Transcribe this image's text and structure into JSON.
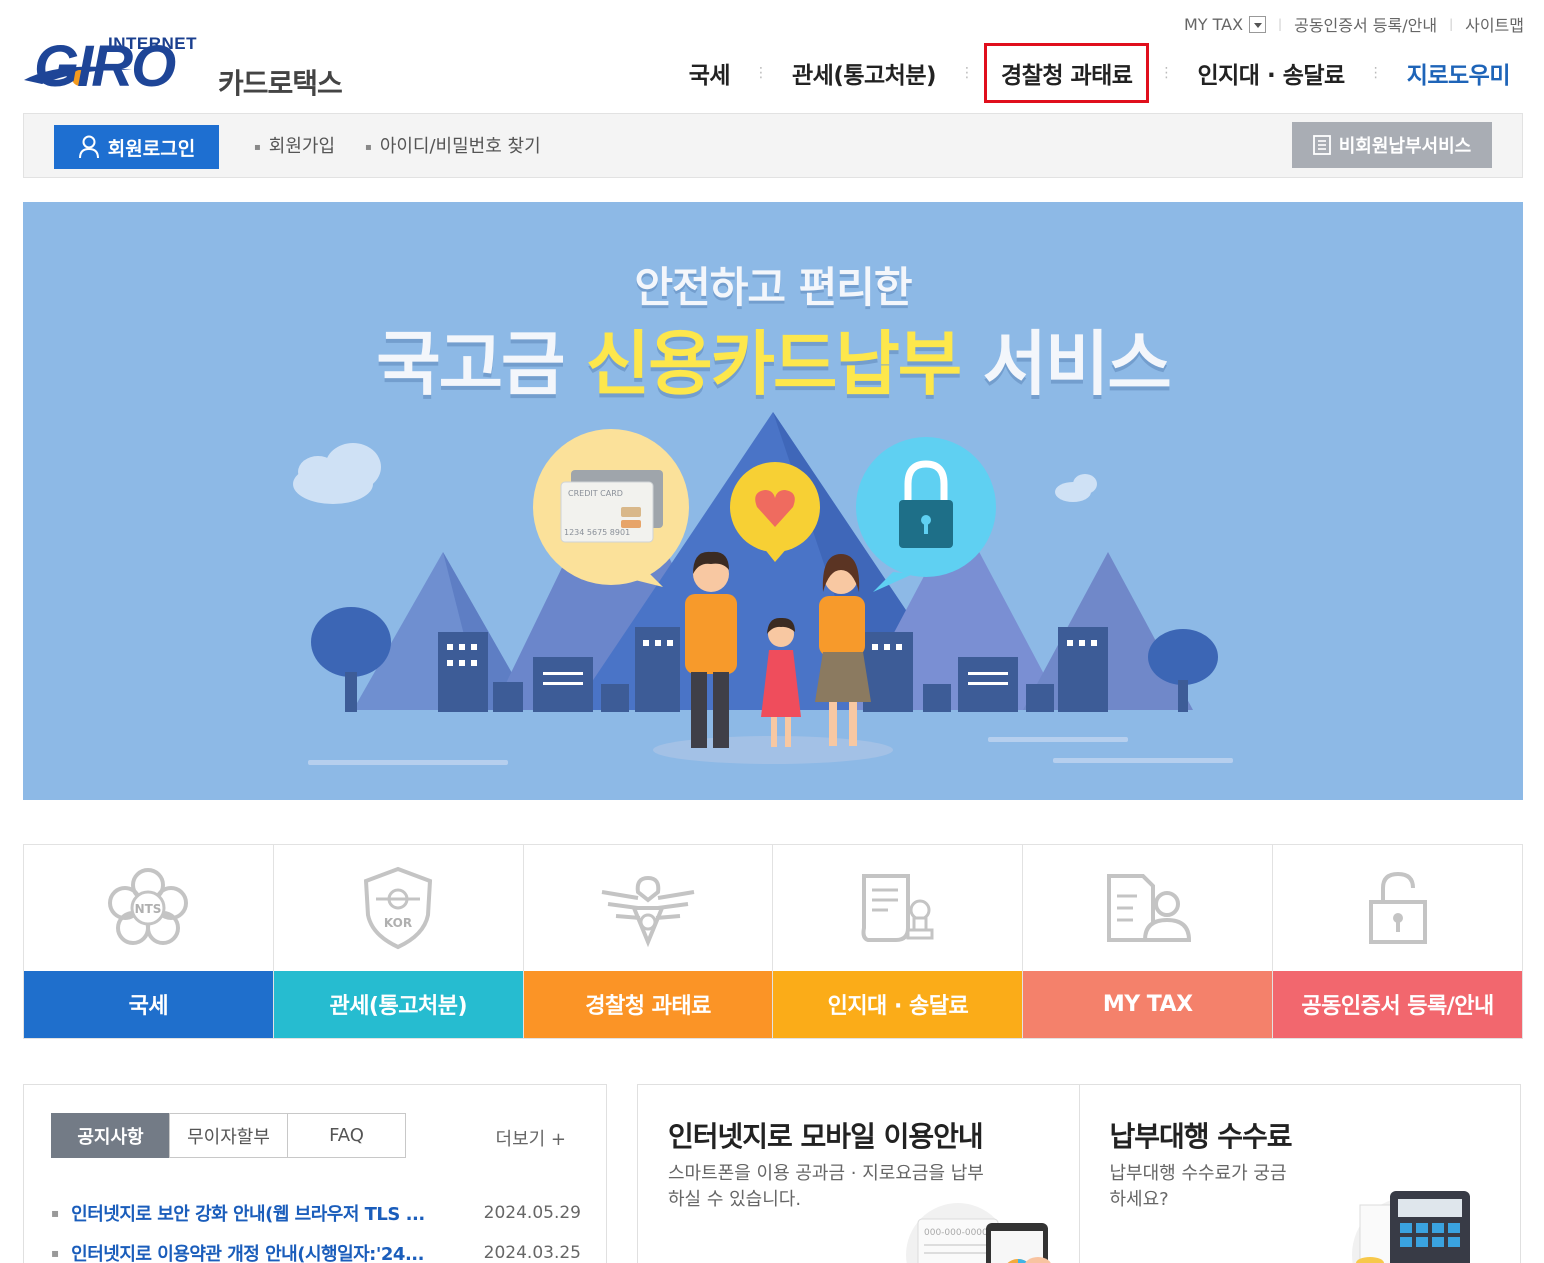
{
  "util_links": {
    "mytax": "MY TAX",
    "cert": "공동인증서 등록/안내",
    "sitemap": "사이트맵"
  },
  "logo": {
    "internet": "INTERNET",
    "giro": "GIRO",
    "cardtax": "카드로택스"
  },
  "gnb": [
    "국세",
    "관세(통고처분)",
    "경찰청 과태료",
    "인지대 · 송달료",
    "지로도우미"
  ],
  "member": {
    "login": "회원로그인",
    "join": "회원가입",
    "find": "아이디/비밀번호 찾기",
    "guest": "비회원납부서비스"
  },
  "banner": {
    "line1": "안전하고 편리한",
    "line2_a": "국고금 ",
    "line2_b": "신용카드납부",
    "line2_c": " 서비스",
    "card_text": "CREDIT CARD",
    "card_number": "1234 5675 8901"
  },
  "quick_menu": [
    {
      "label": "국세",
      "color": "#1f6fcc",
      "icon": "nts-emblem-icon",
      "icon_text": "NTS"
    },
    {
      "label": "관세(통고처분)",
      "color": "#26bcd0",
      "icon": "customs-shield-icon",
      "icon_text": "KOR"
    },
    {
      "label": "경찰청 과태료",
      "color": "#fb9426",
      "icon": "police-eagle-icon"
    },
    {
      "label": "인지대 · 송달료",
      "color": "#fbac18",
      "icon": "document-stamp-icon"
    },
    {
      "label": "MY TAX",
      "color": "#f4816b",
      "icon": "user-document-icon"
    },
    {
      "label": "공동인증서 등록/안내",
      "color": "#f2676e",
      "icon": "padlock-icon"
    }
  ],
  "notice": {
    "tabs": [
      "공지사항",
      "무이자할부",
      "FAQ"
    ],
    "more": "더보기 +",
    "items": [
      {
        "title": "인터넷지로 보안 강화 안내(웹 브라우저 TLS ...",
        "date": "2024.05.29"
      },
      {
        "title": "인터넷지로 이용약관 개정 안내(시행일자:'24...",
        "date": "2024.03.25"
      }
    ]
  },
  "info_boxes": [
    {
      "title": "인터넷지로 모바일 이용안내",
      "desc": "스마트폰을 이용 공과금 · 지로요금을 납부하실 수 있습니다.",
      "phone_text": "000-000-0000"
    },
    {
      "title": "납부대행 수수료",
      "desc": "납부대행 수수료가 궁금하세요?"
    }
  ]
}
